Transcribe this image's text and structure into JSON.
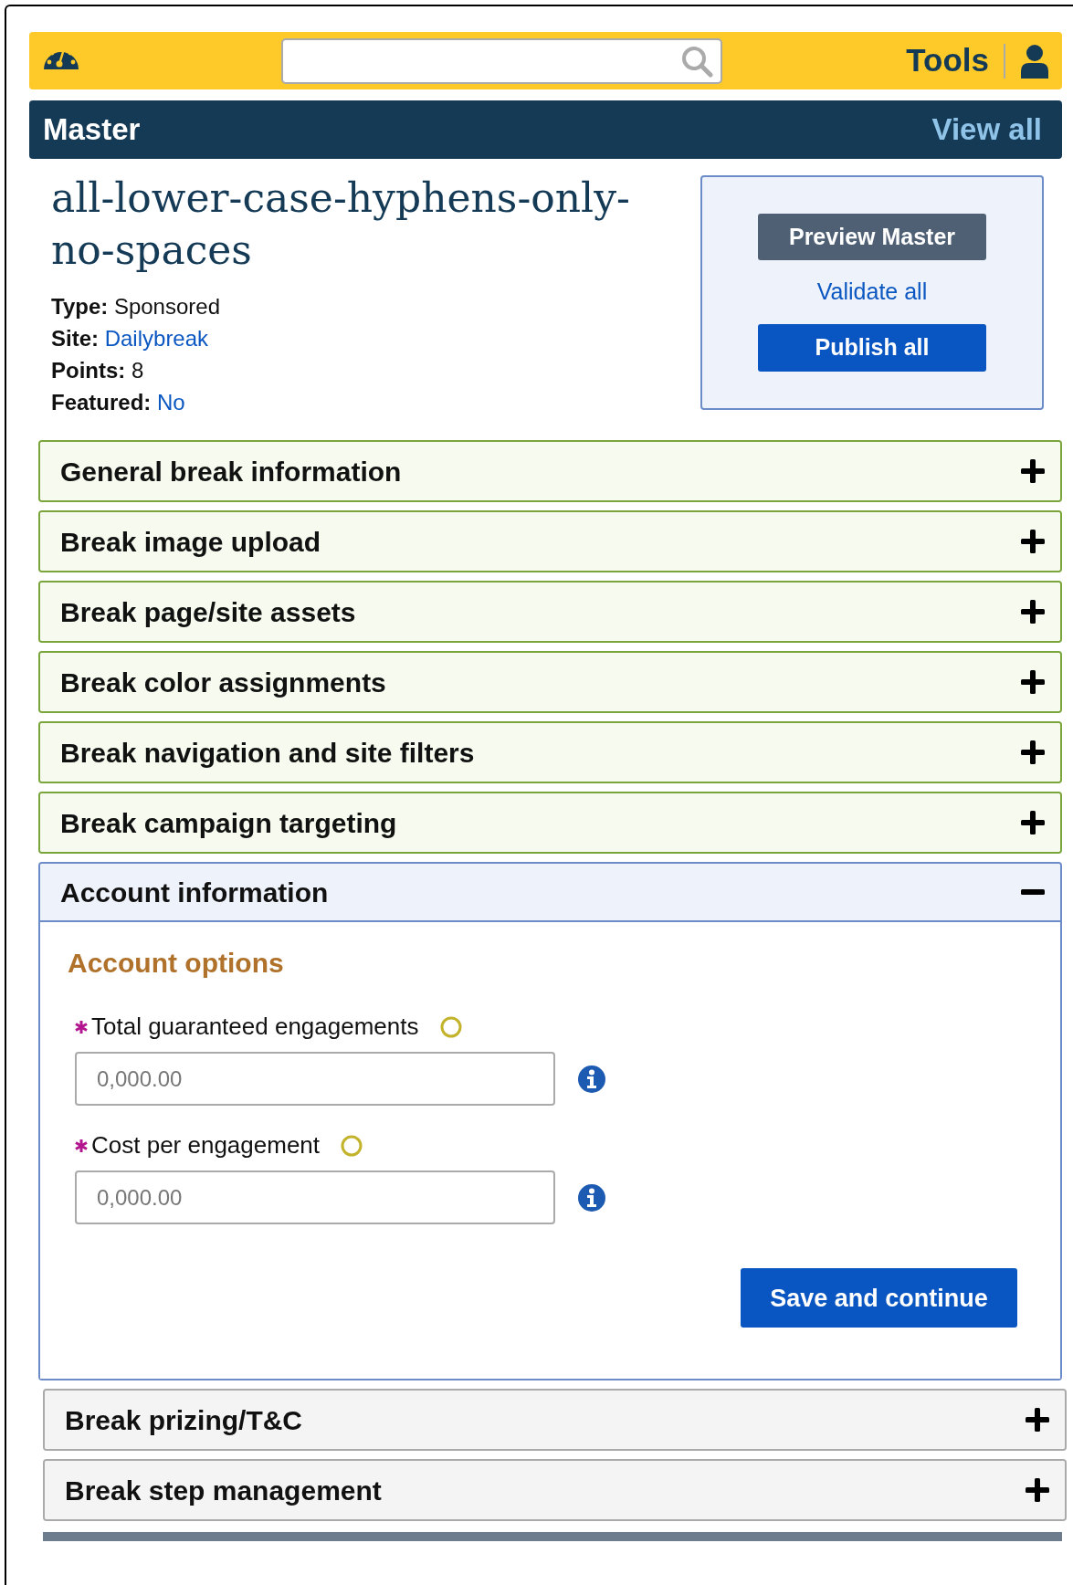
{
  "topbar": {
    "tools_label": "Tools"
  },
  "header": {
    "title": "Master",
    "link": "View all"
  },
  "item": {
    "name": "all-lower-case-hyphens-only-no-spaces",
    "details": [
      {
        "label": "Type:",
        "value": "Sponsored",
        "link": false
      },
      {
        "label": "Site:",
        "value": "Dailybreak",
        "link": true
      },
      {
        "label": "Points:",
        "value": "8",
        "link": false
      },
      {
        "label": "Featured:",
        "value": "No",
        "link": true
      }
    ]
  },
  "actions": {
    "preview": "Preview Master",
    "validate": "Validate all",
    "publish": "Publish all"
  },
  "sections": [
    {
      "title": "General break information",
      "kind": "complete",
      "expanded": false
    },
    {
      "title": "Break image upload",
      "kind": "complete",
      "expanded": false
    },
    {
      "title": "Break page/site assets",
      "kind": "complete",
      "expanded": false
    },
    {
      "title": "Break color assignments",
      "kind": "complete",
      "expanded": false
    },
    {
      "title": "Break navigation and site filters",
      "kind": "complete",
      "expanded": false
    },
    {
      "title": "Break campaign targeting",
      "kind": "complete",
      "expanded": false
    },
    {
      "title": "Account information",
      "kind": "active",
      "expanded": true,
      "subtitle": "Account options",
      "fields": [
        {
          "label": "Total guaranteed engagements",
          "placeholder": "0,000.00",
          "required": true
        },
        {
          "label": "Cost per engagement",
          "placeholder": "0,000.00",
          "required": true
        }
      ],
      "submit": "Save and continue"
    },
    {
      "title": "Break prizing/T&C",
      "kind": "incomplete",
      "expanded": false
    },
    {
      "title": "Break step management",
      "kind": "incomplete",
      "expanded": false
    }
  ]
}
